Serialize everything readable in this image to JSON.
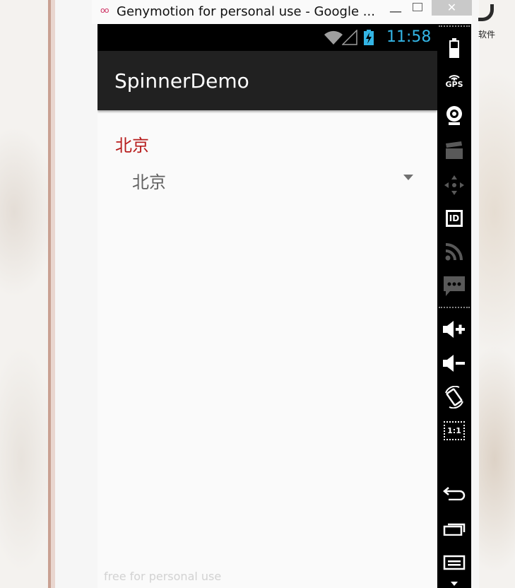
{
  "window": {
    "title": "Genymotion for personal use - Google ...",
    "logo": "oo",
    "minimize": "—",
    "close": "✕"
  },
  "desktop": {
    "side_text": "软件"
  },
  "statusbar": {
    "time": "11:58"
  },
  "app": {
    "title": "SpinnerDemo",
    "label": "北京",
    "spinner_value": "北京",
    "accent_color": "#b71c1c",
    "clock_color": "#33b5e5"
  },
  "watermark": "free for personal use",
  "toolbar": {
    "items": [
      "battery-icon",
      "gps-icon",
      "webcam-icon",
      "capture-icon",
      "dpad-icon",
      "device-id-icon",
      "rss-icon",
      "sms-icon",
      "volume-up-icon",
      "volume-down-icon",
      "rotate-icon",
      "scale-icon",
      "back-icon",
      "recent-apps-icon",
      "menu-icon"
    ],
    "gps_label": "GPS",
    "id_label": "ID",
    "scale_label": "1:1"
  }
}
